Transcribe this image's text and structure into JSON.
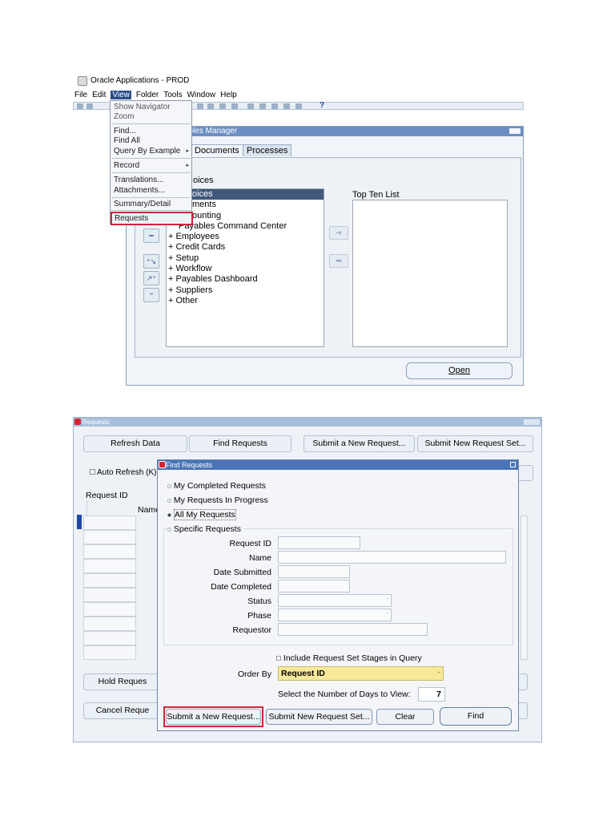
{
  "top": {
    "app_title": "Oracle Applications - PROD",
    "menubar": [
      "File",
      "Edit",
      "View",
      "Folder",
      "Tools",
      "Window",
      "Help"
    ],
    "toolbar_help": "?",
    "view_menu": {
      "items": [
        {
          "label": "Show Navigator"
        },
        {
          "label": "Zoom"
        },
        {
          "label": "Find..."
        },
        {
          "label": "Find All"
        },
        {
          "label": "Query By Example"
        },
        {
          "label": "Record"
        },
        {
          "label": "Translations..."
        },
        {
          "label": "Attachments..."
        },
        {
          "label": "Summary/Detail"
        },
        {
          "label": "Requests"
        }
      ],
      "submenu_arrow": "▸"
    },
    "navigator": {
      "title_fragment": "ables Manager",
      "tabs": [
        "Documents",
        "Processes"
      ],
      "section_fragment": "oices",
      "tree": [
        "oices",
        "ments",
        "ounting",
        "Payables Command Center",
        "+  Employees",
        "+  Credit Cards",
        "+  Setup",
        "+  Workflow",
        "+  Payables Dashboard",
        "+  Suppliers",
        "+  Other"
      ],
      "top_ten_label": "Top Ten List",
      "open_button": "Open"
    }
  },
  "bottom": {
    "requests_window": {
      "title": "Requests",
      "buttons": [
        "Refresh Data",
        "Find Requests",
        "Submit a New Request...",
        "Submit New Request Set..."
      ],
      "auto_refresh": "Auto Refresh (K)",
      "request_id_header": "Request ID",
      "name_header": "Name",
      "hold_button": "Hold Reques",
      "cancel_button": "Cancel Reque"
    },
    "find_requests": {
      "title": "Find Requests",
      "radios": [
        "My Completed Requests",
        "My Requests In Progress",
        "All My Requests"
      ],
      "specific_group": "Specific Requests",
      "fields": [
        {
          "label": "Request ID",
          "value": ""
        },
        {
          "label": "Name",
          "value": ""
        },
        {
          "label": "Date Submitted",
          "value": ""
        },
        {
          "label": "Date Completed",
          "value": ""
        },
        {
          "label": "Status",
          "value": ""
        },
        {
          "label": "Phase",
          "value": ""
        },
        {
          "label": "Requestor",
          "value": ""
        }
      ],
      "include_stages": "Include Request Set Stages in Query",
      "order_by_label": "Order By",
      "order_by_value": "Request ID",
      "days_label": "Select the Number of Days to View:",
      "days_value": "7",
      "buttons": [
        "Submit a New Request...",
        "Submit New Request Set...",
        "Clear",
        "Find"
      ]
    }
  },
  "colors": {
    "highlight": "#d3243a",
    "selected_row": "#40587c",
    "orderby_bg": "#f8e99a"
  }
}
